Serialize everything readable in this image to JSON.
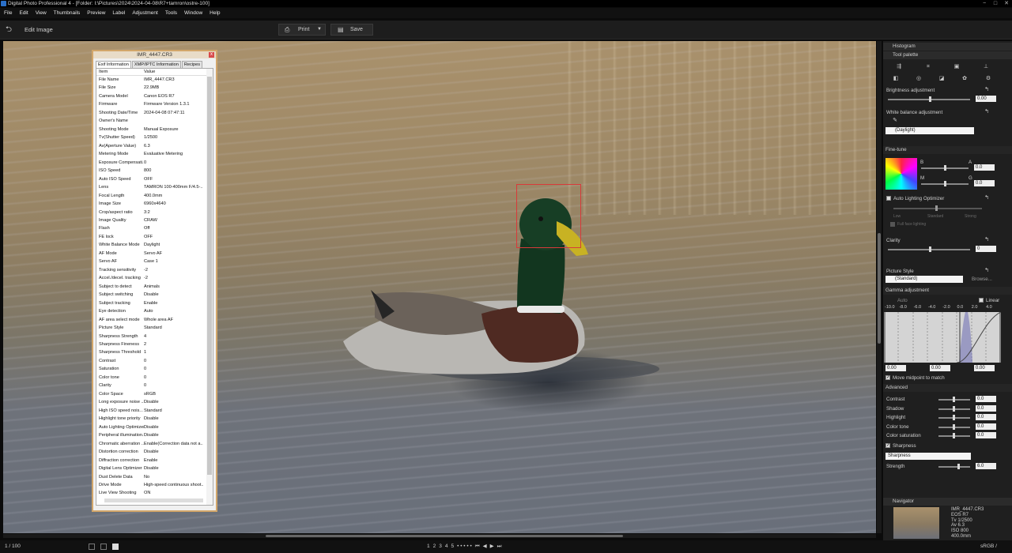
{
  "window": {
    "title": "Digital Photo Professional 4 - [Folder: I:\\Pictures\\2024\\2024-04-08\\R7+tamron\\ostre-100]",
    "min": "−",
    "max": "□",
    "close": "✕"
  },
  "menu": [
    "File",
    "Edit",
    "View",
    "Thumbnails",
    "Preview",
    "Label",
    "Adjustment",
    "Tools",
    "Window",
    "Help"
  ],
  "toolbar": {
    "edit_label": "Edit Image",
    "print": "Print",
    "save": "Save"
  },
  "exif": {
    "title": "IMR_4447.CR3",
    "tabs": [
      "Exif Information",
      "XMP/IPTC Information",
      "Recipes"
    ],
    "col_item": "Item",
    "col_value": "Value",
    "rows": [
      [
        "File Name",
        "IMR_4447.CR3"
      ],
      [
        "File Size",
        "22.9MB"
      ],
      [
        "Camera Model",
        "Canon EOS R7"
      ],
      [
        "Firmware",
        "Firmware Version 1.3.1"
      ],
      [
        "Shooting Date/Time",
        "2024-04-08 07:47:11"
      ],
      [
        "Owner's Name",
        ""
      ],
      [
        "Shooting Mode",
        "Manual Exposure"
      ],
      [
        "Tv(Shutter Speed)",
        "1/2500"
      ],
      [
        "Av(Aperture Value)",
        "6.3"
      ],
      [
        "Metering Mode",
        "Evaluative Metering"
      ],
      [
        "Exposure Compensati...",
        "0"
      ],
      [
        "ISO Speed",
        "800"
      ],
      [
        "Auto ISO Speed",
        "OFF"
      ],
      [
        "Lens",
        "TAMRON 100-400mm F/4.5-..."
      ],
      [
        "Focal Length",
        "400.0mm"
      ],
      [
        "Image Size",
        "6960x4640"
      ],
      [
        "Crop/aspect ratio",
        "3:2"
      ],
      [
        "Image Quality",
        "CRAW"
      ],
      [
        "Flash",
        "Off"
      ],
      [
        "FE lock",
        "OFF"
      ],
      [
        "White Balance Mode",
        "Daylight"
      ],
      [
        "AF Mode",
        "Servo AF"
      ],
      [
        "Servo AF",
        "Case 1"
      ],
      [
        "Tracking sensitivity",
        "-2"
      ],
      [
        "Accel./decel. tracking",
        "-2"
      ],
      [
        "Subject to detect",
        "Animals"
      ],
      [
        "Subject switching",
        "Disable"
      ],
      [
        "Subject tracking",
        "Enable"
      ],
      [
        "Eye detection",
        "Auto"
      ],
      [
        "AF area select mode",
        "Whole area AF"
      ],
      [
        "Picture Style",
        "Standard"
      ],
      [
        "Sharpness Strength",
        "4"
      ],
      [
        "Sharpness Fineness",
        "2"
      ],
      [
        "Sharpness Threshold",
        "1"
      ],
      [
        "Contrast",
        "0"
      ],
      [
        "Saturation",
        "0"
      ],
      [
        "Color tone",
        "0"
      ],
      [
        "Clarity",
        "0"
      ],
      [
        "Color Space",
        "sRGB"
      ],
      [
        "Long exposure noise ...",
        "Disable"
      ],
      [
        "High ISO speed nois...",
        "Standard"
      ],
      [
        "Highlight tone priority",
        "Disable"
      ],
      [
        "Auto Lighting Optimizer",
        "Disable"
      ],
      [
        "Peripheral illumination...",
        "Disable"
      ],
      [
        "Chromatic aberration ...",
        "Enable(Correction data not a..."
      ],
      [
        "Distortion correction",
        "Disable"
      ],
      [
        "Diffraction correction",
        "Enable"
      ],
      [
        "Digital Lens Optimizer",
        "Disable"
      ],
      [
        "Dust Delete Data",
        "No"
      ],
      [
        "Drive Mode",
        "High-speed continuous shoot..."
      ],
      [
        "Live View Shooting",
        "ON"
      ]
    ]
  },
  "panel": {
    "histogram": "Histogram",
    "tool_palette": "Tool palette",
    "brightness": "Brightness adjustment",
    "brightness_val": "0.00",
    "wb": "White balance adjustment",
    "wb_preset": "(Daylight)",
    "finetune": "Fine-tune",
    "ft_b": "B",
    "ft_a": "A",
    "ft_m": "M",
    "ft_g": "G",
    "ft_ba_val": "0.0",
    "ft_mg_val": "0.0",
    "alo": "Auto Lighting Optimizer",
    "alo_low": "Low",
    "alo_std": "Standard",
    "alo_strong": "Strong",
    "alo_face": "Full face lighting",
    "clarity": "Clarity",
    "clarity_val": "0",
    "picture_style": "Picture Style",
    "ps_value": "(Standard)",
    "browse": "Browse...",
    "gamma": "Gamma adjustment",
    "auto": "Auto",
    "linear": "Linear",
    "gamma_ticks": [
      "-10.0",
      "-8.0",
      "-6.0",
      "-4.0",
      "-2.0",
      "0.0",
      "2.0",
      "4.0"
    ],
    "gamma_vals": [
      "0.00",
      "0.00",
      "0.00"
    ],
    "move_mid": "Move midpoint to match",
    "advanced": "Advanced",
    "adv": [
      [
        "Contrast",
        "0.0"
      ],
      [
        "Shadow",
        "0.0"
      ],
      [
        "Highlight",
        "0.0"
      ],
      [
        "Color tone",
        "0.0"
      ],
      [
        "Color saturation",
        "0.0"
      ]
    ],
    "sharpness": "Sharpness",
    "sharp_mode": "Sharpness",
    "strength": "Strength",
    "strength_val": "6.0",
    "navigator": "Navigator",
    "nav_info": [
      "IMR_4447.CR3",
      "EOS R7",
      "Tv 1/2500",
      "Av 6.3",
      "ISO 800",
      "400.0mm"
    ]
  },
  "status": {
    "count": "1 / 100",
    "colorspace": "sRGB / sRGB",
    "nav": [
      "1",
      "2",
      "3",
      "4",
      "5"
    ]
  }
}
